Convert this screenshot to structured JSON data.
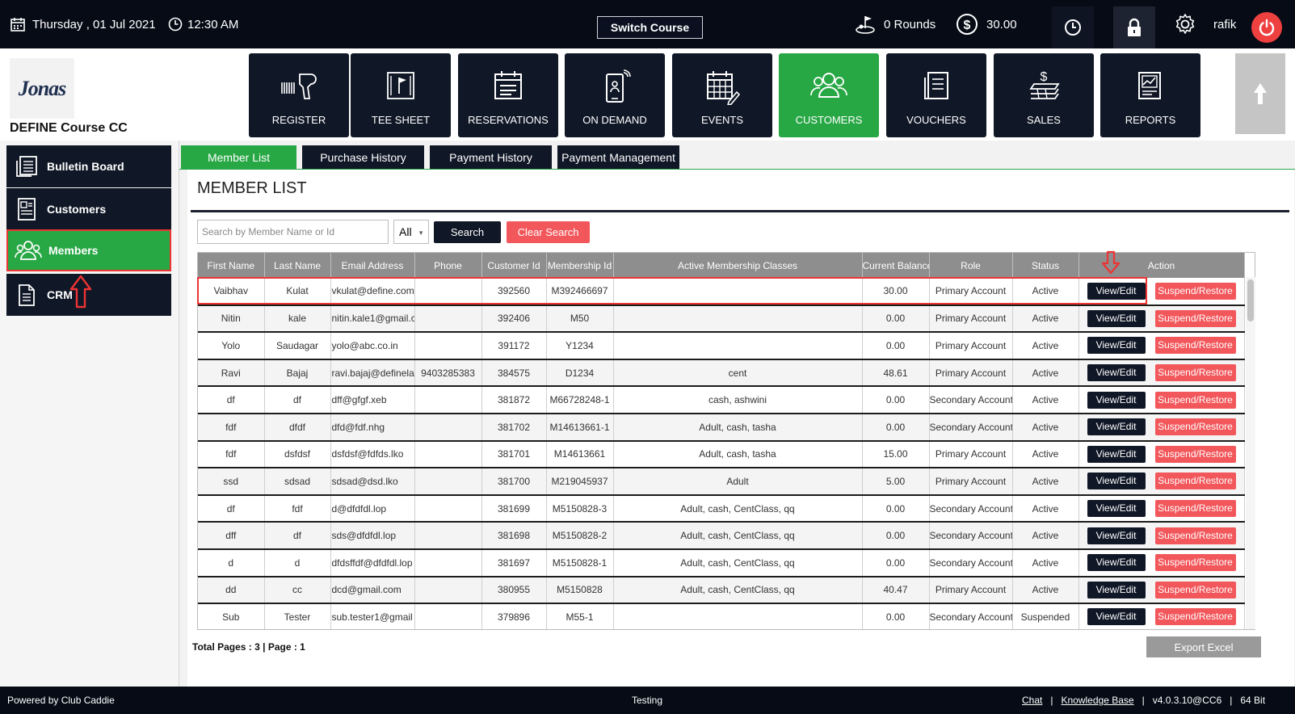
{
  "topbar": {
    "date": "Thursday ,  01 Jul 2021",
    "time": "12:30 AM",
    "switch_course": "Switch Course",
    "rounds": "0 Rounds",
    "balance": "30.00",
    "user": "rafik"
  },
  "brand": {
    "logo_text": "Jonas",
    "course_name": "DEFINE Course CC"
  },
  "nav": [
    {
      "label": "REGISTER",
      "icon": "barcode-scanner-icon"
    },
    {
      "label": "TEE SHEET",
      "icon": "golf-flag-icon"
    },
    {
      "label": "RESERVATIONS",
      "icon": "calendar-list-icon"
    },
    {
      "label": "ON DEMAND",
      "icon": "mobile-phone-icon"
    },
    {
      "label": "EVENTS",
      "icon": "calendar-grid-icon"
    },
    {
      "label": "CUSTOMERS",
      "icon": "users-icon",
      "active": true
    },
    {
      "label": "VOUCHERS",
      "icon": "receipt-icon"
    },
    {
      "label": "SALES",
      "icon": "money-stack-icon"
    },
    {
      "label": "REPORTS",
      "icon": "chart-report-icon"
    }
  ],
  "sidebar": [
    {
      "label": "Bulletin Board"
    },
    {
      "label": "Customers"
    },
    {
      "label": "Members",
      "active": true
    },
    {
      "label": "CRM"
    }
  ],
  "tabs": [
    "Member List",
    "Purchase History",
    "Payment History",
    "Payment Management"
  ],
  "page_title": "MEMBER LIST",
  "search": {
    "placeholder": "Search by Member Name or Id",
    "filter": "All",
    "search_label": "Search",
    "clear_label": "Clear Search"
  },
  "table": {
    "columns": [
      "First Name",
      "Last Name",
      "Email Address",
      "Phone",
      "Customer Id",
      "Membership Id",
      "Active Membership Classes",
      "Current Balance",
      "Role",
      "Status",
      "Action"
    ],
    "view_label": "View/Edit",
    "suspend_label": "Suspend/Restore",
    "rows": [
      [
        "Vaibhav",
        "Kulat",
        "vkulat@define.com",
        "",
        "392560",
        "M392466697",
        "",
        "30.00",
        "Primary Account",
        "Active"
      ],
      [
        "Nitin",
        "kale",
        "nitin.kale1@gmail.c",
        "",
        "392406",
        "M50",
        "",
        "0.00",
        "Primary Account",
        "Active"
      ],
      [
        "Yolo",
        "Saudagar",
        "yolo@abc.co.in",
        "",
        "391172",
        "Y1234",
        "",
        "0.00",
        "Primary Account",
        "Active"
      ],
      [
        "Ravi",
        "Bajaj",
        "ravi.bajaj@definela",
        "9403285383",
        "384575",
        "D1234",
        "cent",
        "48.61",
        "Primary Account",
        "Active"
      ],
      [
        "df",
        "df",
        "dff@gfgf.xeb",
        "",
        "381872",
        "M66728248-1",
        "cash, ashwini",
        "0.00",
        "Secondary Account",
        "Active"
      ],
      [
        "fdf",
        "dfdf",
        "dfd@fdf.nhg",
        "",
        "381702",
        "M14613661-1",
        "Adult, cash, tasha",
        "0.00",
        "Secondary Account",
        "Active"
      ],
      [
        "fdf",
        "dsfdsf",
        "dsfdsf@fdfds.lko",
        "",
        "381701",
        "M14613661",
        "Adult, cash, tasha",
        "15.00",
        "Primary Account",
        "Active"
      ],
      [
        "ssd",
        "sdsad",
        "sdsad@dsd.lko",
        "",
        "381700",
        "M219045937",
        "Adult",
        "5.00",
        "Primary Account",
        "Active"
      ],
      [
        "df",
        "fdf",
        "d@dfdfdl.lop",
        "",
        "381699",
        "M5150828-3",
        "Adult, cash, CentClass, qq",
        "0.00",
        "Secondary Account",
        "Active"
      ],
      [
        "dff",
        "df",
        "sds@dfdfdl.lop",
        "",
        "381698",
        "M5150828-2",
        "Adult, cash, CentClass, qq",
        "0.00",
        "Secondary Account",
        "Active"
      ],
      [
        "d",
        "d",
        "dfdsffdf@dfdfdl.lop",
        "",
        "381697",
        "M5150828-1",
        "Adult, cash, CentClass, qq",
        "0.00",
        "Secondary Account",
        "Active"
      ],
      [
        "dd",
        "cc",
        "dcd@gmail.com",
        "",
        "380955",
        "M5150828",
        "Adult, cash, CentClass, qq",
        "40.47",
        "Primary Account",
        "Active"
      ],
      [
        "Sub",
        "Tester",
        "sub.tester1@gmail",
        "",
        "379896",
        "M55-1",
        "",
        "0.00",
        "Secondary Account",
        "Suspended"
      ]
    ]
  },
  "pagination": "Total Pages : 3 | Page : 1",
  "export_label": "Export Excel",
  "footer": {
    "powered": "Powered by Club Caddie",
    "env": "Testing",
    "chat": "Chat",
    "kb": "Knowledge Base",
    "version": "v4.0.3.10@CC6",
    "bits": "64 Bit",
    "sep": "|"
  },
  "colors": {
    "accent": "#28a745",
    "dark": "#101726",
    "danger": "#f2575b"
  }
}
